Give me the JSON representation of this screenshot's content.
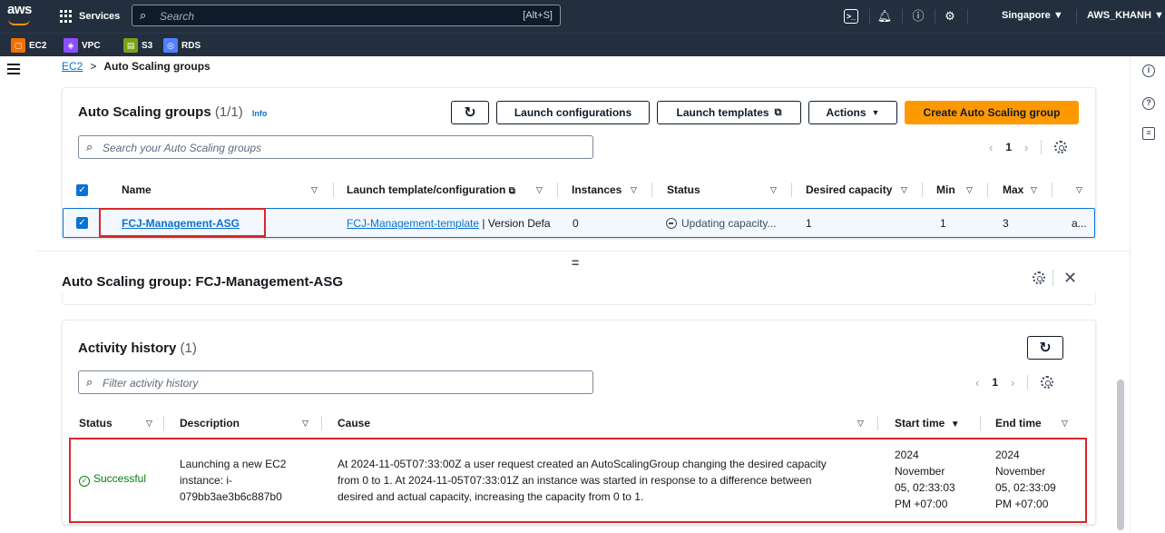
{
  "topnav": {
    "logo_text": "aws",
    "services_label": "Services",
    "search_placeholder": "Search",
    "search_shortcut": "[Alt+S]",
    "region": "Singapore ▼",
    "account": "AWS_KHANH ▼",
    "icons": [
      "cloudshell-icon",
      "bell-icon",
      "help-icon",
      "settings-icon"
    ]
  },
  "favorites": [
    {
      "label": "EC2",
      "color": "#ed7100"
    },
    {
      "label": "VPC",
      "color": "#8c4fff"
    },
    {
      "label": "S3",
      "color": "#7aa116"
    },
    {
      "label": "RDS",
      "color": "#527fff"
    }
  ],
  "breadcrumb": {
    "parent": "EC2",
    "separator": ">",
    "current": "Auto Scaling groups"
  },
  "asg_list": {
    "title": "Auto Scaling groups",
    "count": "(1/1)",
    "info": "Info",
    "refresh_icon": "↻",
    "buttons": {
      "launch_configurations": "Launch configurations",
      "launch_templates": "Launch templates",
      "actions": "Actions",
      "create": "Create Auto Scaling group"
    },
    "search_placeholder": "Search your Auto Scaling groups",
    "pager": {
      "prev": "‹",
      "page": "1",
      "next": "›"
    },
    "columns": [
      "Name",
      "Launch template/configuration",
      "Instances",
      "Status",
      "Desired capacity",
      "Min",
      "Max"
    ],
    "row": {
      "name": "FCJ-Management-ASG",
      "template_link": "FCJ-Management-template",
      "template_rest": " | Version Defa",
      "instances": "0",
      "status": "Updating capacity...",
      "desired": "1",
      "min": "1",
      "max": "3",
      "extra": "a..."
    }
  },
  "split_panel": {
    "handle": "=",
    "title": "Auto Scaling group: FCJ-Management-ASG",
    "close": "✕"
  },
  "activity": {
    "title": "Activity history",
    "count": "(1)",
    "filter_placeholder": "Filter activity history",
    "pager": {
      "prev": "‹",
      "page": "1",
      "next": "›"
    },
    "columns": {
      "status": "Status",
      "description": "Description",
      "cause": "Cause",
      "start": "Start time",
      "end": "End time"
    },
    "row": {
      "status": "Successful",
      "description": [
        "Launching a new EC2",
        "instance: i-",
        "079bb3ae3b6c887b0"
      ],
      "cause": [
        "At 2024-11-05T07:33:00Z a user request created an AutoScalingGroup changing the desired capacity",
        "from 0 to 1. At 2024-11-05T07:33:01Z an instance was started in response to a difference between",
        "desired and actual capacity, increasing the capacity from 0 to 1."
      ],
      "start": [
        "2024",
        "November",
        "05, 02:33:03",
        "PM +07:00"
      ],
      "end": [
        "2024",
        "November",
        "05, 02:33:09",
        "PM +07:00"
      ]
    }
  }
}
